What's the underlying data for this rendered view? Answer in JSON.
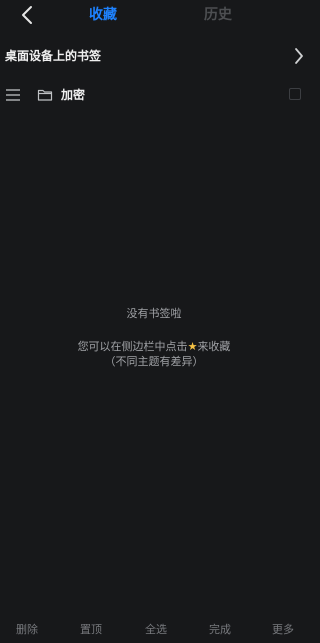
{
  "header": {
    "tabs": [
      {
        "label": "收藏",
        "active": true
      },
      {
        "label": "历史",
        "active": false
      }
    ],
    "accent_color": "#1e82ff"
  },
  "bookmarks_section": {
    "title": "桌面设备上的书签"
  },
  "folder": {
    "label": "加密"
  },
  "empty_state": {
    "title": "没有书签啦",
    "hint_before": "您可以在侧边栏中点击",
    "hint_icon": "star-icon",
    "hint_after": "来收藏",
    "note": "（不同主题有差异）"
  },
  "bottom_bar": {
    "items": [
      "删除",
      "置顶",
      "全选",
      "完成",
      "更多"
    ]
  }
}
